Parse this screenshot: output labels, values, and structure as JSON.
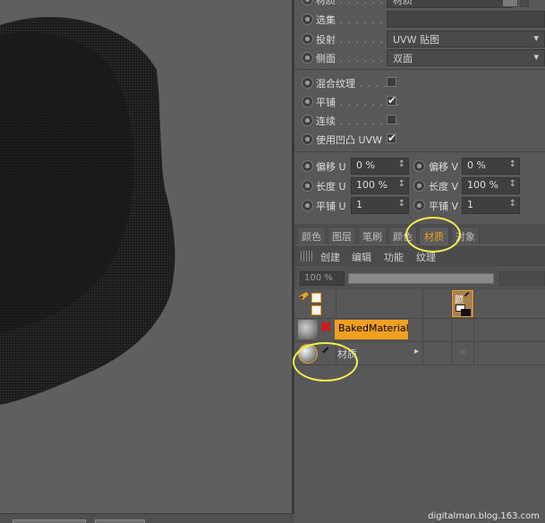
{
  "attributes": {
    "material_label": "材质",
    "material_value": "材质",
    "selection_label": "选集",
    "selection_value": "",
    "projection_label": "投射",
    "projection_value": "UVW 贴图",
    "side_label": "侧面",
    "side_value": "双面",
    "mix_label": "混合纹理",
    "mix_checked": false,
    "tile_label": "平铺",
    "tile_checked": true,
    "seamless_label": "连续",
    "seamless_checked": false,
    "bump_uvw_label": "使用凹凸 UVW",
    "bump_uvw_checked": true,
    "offset_u_label": "偏移 U",
    "offset_u_value": "0 %",
    "offset_v_label": "偏移 V",
    "offset_v_value": "0 %",
    "length_u_label": "长度 U",
    "length_u_value": "100 %",
    "length_v_label": "长度 V",
    "length_v_value": "100 %",
    "tiles_u_label": "平铺 U",
    "tiles_u_value": "1",
    "tiles_v_label": "平铺 V",
    "tiles_v_value": "1",
    "check_glyph": "✔"
  },
  "tabs": [
    "颜色",
    "图层",
    "笔刷",
    "颜色",
    "材质",
    "对象"
  ],
  "active_tab_index": 4,
  "material_manager": {
    "menu": [
      "创建",
      "编辑",
      "功能",
      "纹理"
    ],
    "zoom_value": "100 %",
    "column_header_label": "颜",
    "baked_material_name": "BakedMaterial",
    "material_name": "材质",
    "arrow_glyph": "▸",
    "x_glyph": "✕"
  },
  "watermark": "digitalman.blog.163.com",
  "colors": {
    "accent": "#f0a020",
    "highlight_circle": "#f2ef50",
    "error_x": "#e01010"
  }
}
